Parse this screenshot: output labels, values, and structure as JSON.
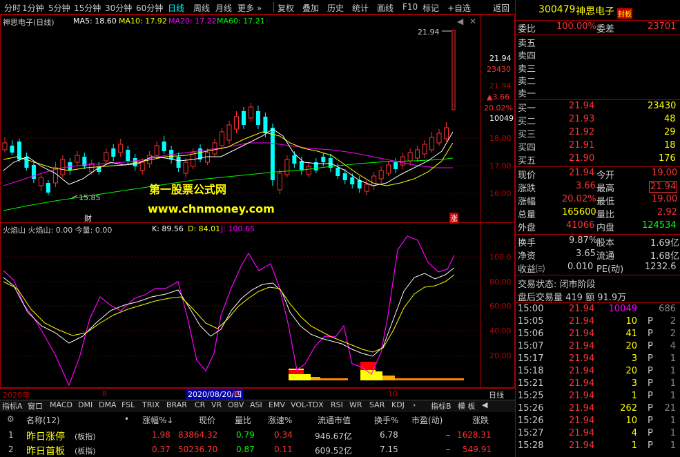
{
  "toolbar": {
    "items": [
      "分时",
      "1分钟",
      "5分钟",
      "15分钟",
      "30分钟",
      "60分钟",
      "日线",
      "周线",
      "月线",
      "更多 »",
      "复权",
      "叠加",
      "历史",
      "统计",
      "画线",
      "F10",
      "标记",
      "+自选",
      "返回"
    ],
    "active": "日线"
  },
  "chart": {
    "stock_label": "神思电子(日线)",
    "ma5": "MA5: 18.60",
    "ma10": "MA10: 17.92",
    "ma20": "MA20: 17.22",
    "ma60": "MA60: 17.21",
    "price_axis": [
      "21.94",
      "23430",
      "21.94",
      "▲3.66",
      "20.02%",
      "10049",
      "18.00",
      "17.00",
      "16.00"
    ],
    "high_marker": "21.94",
    "low_marker": "15.85",
    "watermark1": "第一股票公式网",
    "watermark2": "www.chnmoney.com",
    "cai_tag": "财",
    "zhang_tag": "涨",
    "colors": {
      "up": "#ff3232",
      "down": "#00ffff",
      "ma5": "#ffffff",
      "ma10": "#ffff00",
      "ma20": "#ff00ff",
      "ma60": "#00ff00",
      "frame": "#aa0000"
    }
  },
  "indicator": {
    "title": "火焰山  火焰山: 0.00   今量: 0.00",
    "k": "K: 89.56",
    "d": "D: 84.01",
    "j": "J: 100.65",
    "axis": [
      "100.0",
      "80.00",
      "60.00",
      "40.00",
      "20.00"
    ]
  },
  "date_axis": {
    "y2020": "2020年",
    "m8": "8",
    "selected": "2020/08/20/四",
    "m9": "9",
    "m10": "10",
    "period": "日线"
  },
  "bottom_tabs": [
    "指标A",
    "窗口",
    "MACD",
    "DMI",
    "DMA",
    "FSL",
    "TRIX",
    "BRAR",
    "CR",
    "VR",
    "OBV",
    "ASI",
    "EMV",
    "VOL-TDX",
    "RSI",
    "WR",
    "SAR",
    "KDJ",
    "›",
    "指标B",
    "模 板",
    "◀"
  ],
  "watchlist": {
    "headers": [
      "名称(12)",
      "•",
      "涨幅%↓",
      "现价",
      "量比",
      "涨速%",
      "流通市值",
      "换手%",
      "市盈(动)",
      "涨跌"
    ],
    "rows": [
      {
        "idx": "1",
        "name": "昨日涨停",
        "tag": "(板指)",
        "chg": "1.98",
        "price": "83864.32",
        "vr": "0.79",
        "speed": "0.34",
        "mcap": "946.67亿",
        "turn": "6.78",
        "pe": "–",
        "diff": "1628.31"
      },
      {
        "idx": "2",
        "name": "昨日首板",
        "tag": "(板指)",
        "chg": "0.37",
        "price": "50236.70",
        "vr": "0.87",
        "speed": "0.11",
        "mcap": "609.52亿",
        "turn": "7.15",
        "pe": "–",
        "diff": "549.91"
      }
    ]
  },
  "sidebar": {
    "code": "300479",
    "name": "神思电子",
    "badge": "封板",
    "weibi_label": "委比",
    "weibi": "100.00%",
    "weicha_label": "委差",
    "weicha": "23701",
    "sells": [
      "卖五",
      "卖四",
      "卖三",
      "卖二",
      "卖一"
    ],
    "buys": [
      {
        "label": "买一",
        "price": "21.94",
        "vol": "23430"
      },
      {
        "label": "买二",
        "price": "21.93",
        "vol": "48"
      },
      {
        "label": "买三",
        "price": "21.92",
        "vol": "29"
      },
      {
        "label": "买四",
        "price": "21.91",
        "vol": "18"
      },
      {
        "label": "买五",
        "price": "21.90",
        "vol": "176"
      }
    ],
    "quote": [
      {
        "l1": "现价",
        "v1": "21.94",
        "l2": "今开",
        "v2": "19.00"
      },
      {
        "l1": "涨跌",
        "v1": "3.66",
        "l2": "最高",
        "v2": "21.94"
      },
      {
        "l1": "涨幅",
        "v1": "20.02%",
        "l2": "最低",
        "v2": "19.00"
      },
      {
        "l1": "总量",
        "v1": "165600",
        "l2": "量比",
        "v2": "2.92"
      },
      {
        "l1": "外盘",
        "v1": "41066",
        "l2": "内盘",
        "v2": "124534"
      }
    ],
    "stats": [
      {
        "l1": "换手",
        "v1": "9.87%",
        "l2": "股本",
        "v2": "1.69亿"
      },
      {
        "l1": "净资",
        "v1": "3.65",
        "l2": "流通",
        "v2": "1.68亿"
      },
      {
        "l1": "收益㈢",
        "v1": "0.010",
        "l2": "PE(动)",
        "v2": "1232.6"
      }
    ],
    "trade_status": "交易状态: 闭市阶段",
    "after_hours": "盘后交易量 419  额 91.9万",
    "ticks": [
      {
        "t": "15:00",
        "p": "21.94",
        "v": "10049",
        "f": "",
        "n": "686"
      },
      {
        "t": "15:05",
        "p": "21.94",
        "v": "10",
        "f": "P",
        "n": "2"
      },
      {
        "t": "15:06",
        "p": "21.94",
        "v": "41",
        "f": "P",
        "n": "2"
      },
      {
        "t": "15:07",
        "p": "21.94",
        "v": "20",
        "f": "P",
        "n": "4"
      },
      {
        "t": "15:17",
        "p": "21.94",
        "v": "3",
        "f": "P",
        "n": "1"
      },
      {
        "t": "15:18",
        "p": "21.94",
        "v": "20",
        "f": "P",
        "n": "1"
      },
      {
        "t": "15:21",
        "p": "21.94",
        "v": "3",
        "f": "P",
        "n": "1"
      },
      {
        "t": "15:25",
        "p": "21.94",
        "v": "1",
        "f": "P",
        "n": "1"
      },
      {
        "t": "15:26",
        "p": "21.94",
        "v": "262",
        "f": "P",
        "n": "21"
      },
      {
        "t": "15:26",
        "p": "21.94",
        "v": "10",
        "f": "P",
        "n": "1"
      },
      {
        "t": "15:27",
        "p": "21.94",
        "v": "4",
        "f": "P",
        "n": "1"
      },
      {
        "t": "15:28",
        "p": "21.94",
        "v": "1",
        "f": "P",
        "n": "1"
      }
    ]
  }
}
